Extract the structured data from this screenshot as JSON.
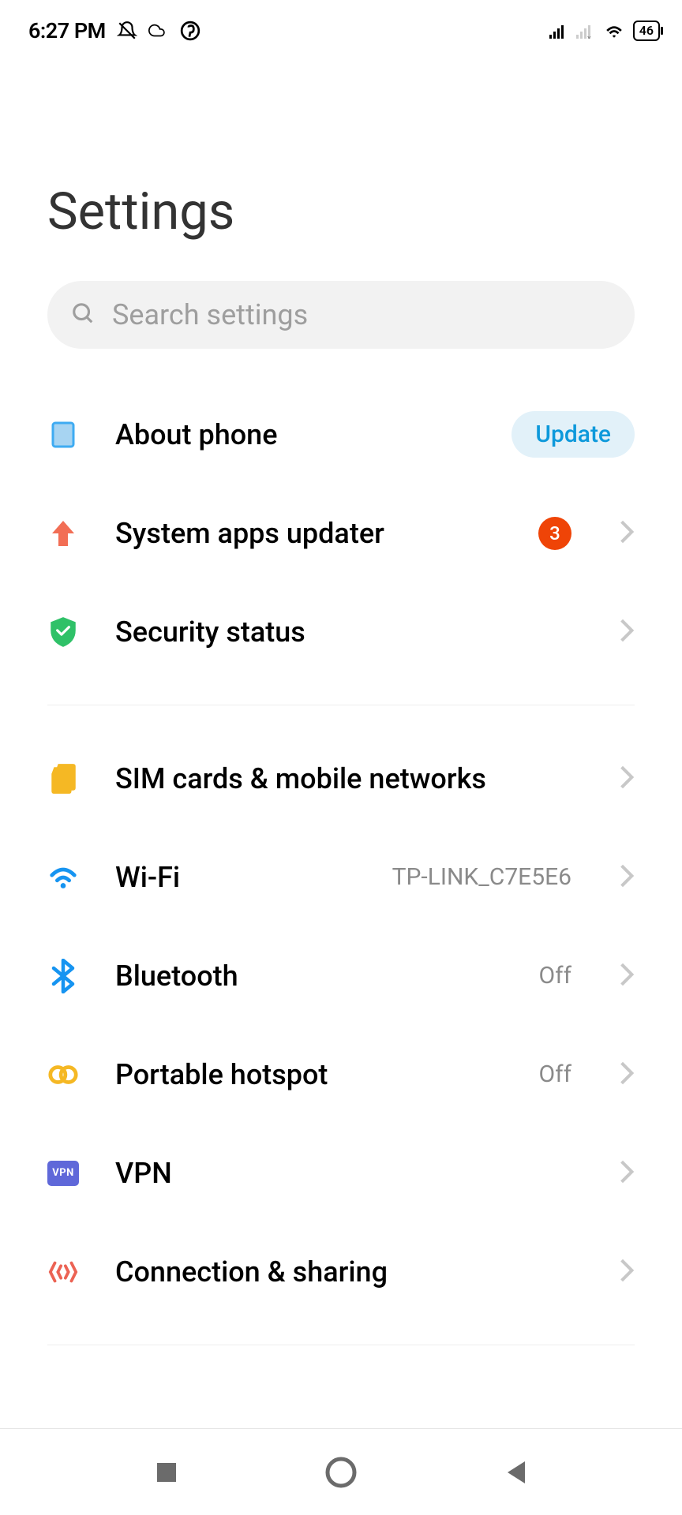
{
  "statusbar": {
    "time": "6:27 PM",
    "battery": "46"
  },
  "page": {
    "title": "Settings"
  },
  "search": {
    "placeholder": "Search settings"
  },
  "items": {
    "about_phone": {
      "label": "About phone",
      "update_label": "Update"
    },
    "system_updater": {
      "label": "System apps updater",
      "badge": "3"
    },
    "security_status": {
      "label": "Security status"
    },
    "sim": {
      "label": "SIM cards & mobile networks"
    },
    "wifi": {
      "label": "Wi-Fi",
      "value": "TP-LINK_C7E5E6"
    },
    "bluetooth": {
      "label": "Bluetooth",
      "value": "Off"
    },
    "hotspot": {
      "label": "Portable hotspot",
      "value": "Off"
    },
    "vpn": {
      "label": "VPN",
      "vpn_icon_text": "VPN"
    },
    "connection_sharing": {
      "label": "Connection & sharing"
    }
  }
}
